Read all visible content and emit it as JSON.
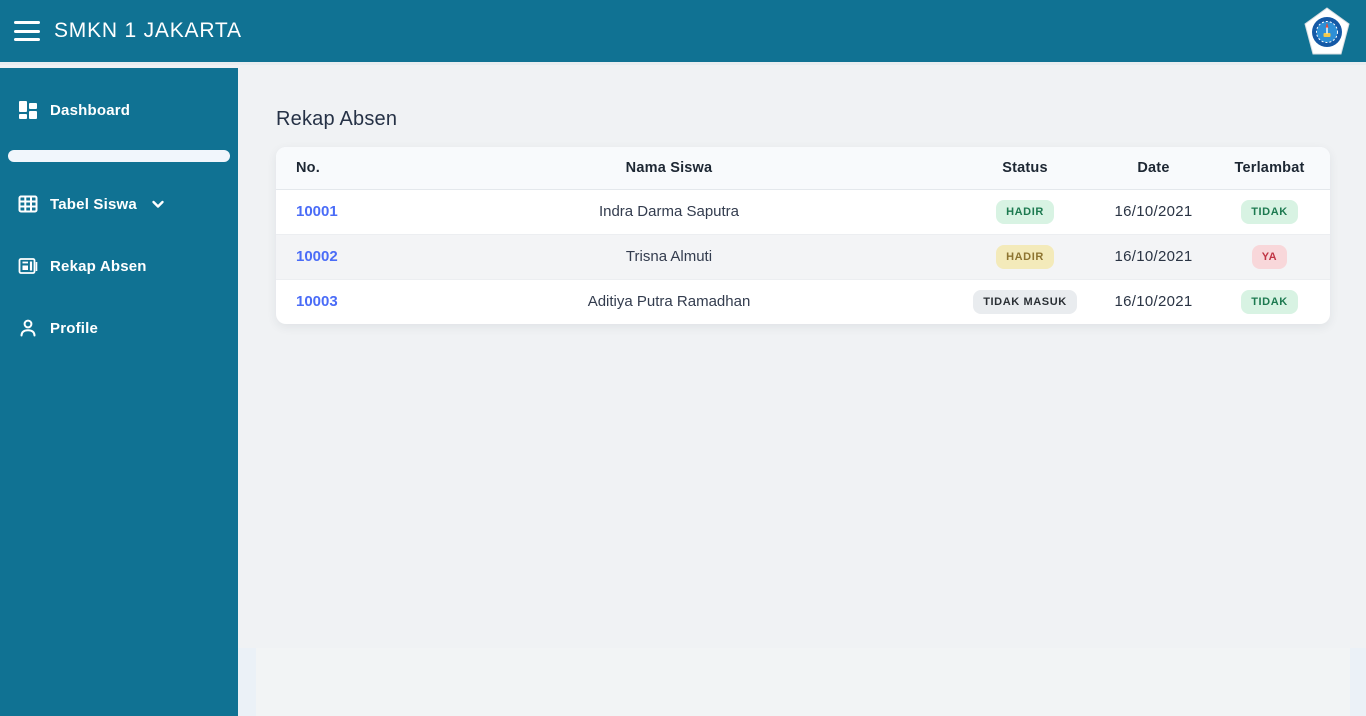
{
  "app": {
    "accent_color": "#107293"
  },
  "header": {
    "title": "SMKN 1 JAKARTA"
  },
  "sidebar": {
    "items": [
      {
        "label": "Dashboard",
        "icon": "dashboard-icon"
      },
      {
        "label": "Tabel Siswa",
        "icon": "table-icon",
        "has_chevron": true
      },
      {
        "label": "Rekap Absen",
        "icon": "journal-icon"
      },
      {
        "label": "Profile",
        "icon": "person-icon"
      }
    ]
  },
  "main": {
    "heading": "Rekap Absen",
    "table": {
      "columns": [
        "No.",
        "Nama Siswa",
        "Status",
        "Date",
        "Terlambat"
      ],
      "rows": [
        {
          "no": "10001",
          "name": "Indra Darma Saputra",
          "status": "HADIR",
          "status_variant": "success",
          "date": "16/10/2021",
          "terlambat": "TIDAK",
          "terlambat_variant": "success"
        },
        {
          "no": "10002",
          "name": "Trisna Almuti",
          "status": "HADIR",
          "status_variant": "warning",
          "date": "16/10/2021",
          "terlambat": "YA",
          "terlambat_variant": "danger"
        },
        {
          "no": "10003",
          "name": "Aditiya Putra Ramadhan",
          "status": "TIDAK MASUK",
          "status_variant": "secondary",
          "date": "16/10/2021",
          "terlambat": "TIDAK",
          "terlambat_variant": "success"
        }
      ]
    }
  },
  "colors": {
    "header_teal": "#107293",
    "main_background": "#f0f2f4",
    "link_blue": "#4a6cf7",
    "badge_success_bg": "#d8f3e3",
    "badge_success_text": "#1d7a50",
    "badge_warning_bg": "#f3eaba",
    "badge_warning_text": "#8d7430",
    "badge_danger_bg": "#f8d7da",
    "badge_danger_text": "#c03444",
    "badge_secondary_bg": "#e9ecef",
    "badge_secondary_text": "#2b3035"
  }
}
